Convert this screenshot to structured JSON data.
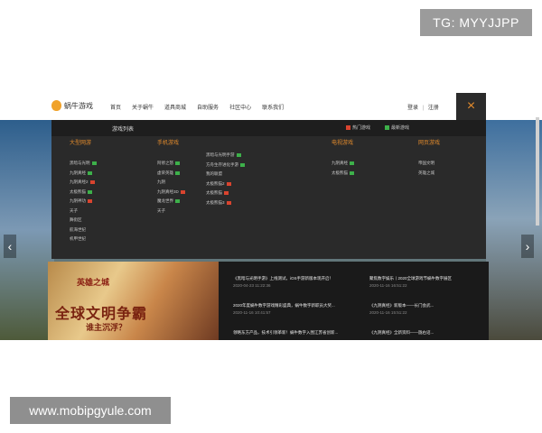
{
  "watermarks": {
    "top": "TG: MYYJJPP",
    "bottom": "www.mobipgyule.com"
  },
  "header": {
    "logo_text": "蜗牛游戏",
    "nav": [
      "首页",
      "关于蜗牛",
      "道具商城",
      "自助服务",
      "社区中心",
      "联系我们"
    ],
    "login": "登录",
    "sep": "|",
    "register": "注册",
    "close_icon": "×"
  },
  "menu": {
    "title": "游戏列表",
    "legend_hot": "热门游戏",
    "legend_new": "最新游戏",
    "colors": {
      "hot": "#d9442f",
      "new": "#3db04a",
      "accent": "#e38b2c"
    },
    "columns": [
      {
        "heading": "大型网游",
        "items": [
          {
            "label": "黑暗与光明",
            "tag": "new"
          },
          {
            "label": "九阴真经",
            "tag": "new"
          },
          {
            "label": "九阴真经2",
            "tag": "hot"
          },
          {
            "label": "太极熊猫",
            "tag": "new"
          },
          {
            "label": "九阴神功",
            "tag": "hot"
          },
          {
            "label": "天子",
            "tag": ""
          },
          {
            "label": "舞街区",
            "tag": ""
          },
          {
            "label": "航海世纪",
            "tag": ""
          },
          {
            "label": "机甲世纪",
            "tag": ""
          }
        ]
      },
      {
        "heading": "手机游戏",
        "items": [
          {
            "label": "阿修之怒",
            "tag": "new"
          },
          {
            "label": "虚荣英雄",
            "tag": "new"
          },
          {
            "label": "九阴",
            "tag": ""
          },
          {
            "label": "九阴真经3D",
            "tag": "hot"
          },
          {
            "label": "魔龙世界",
            "tag": "new"
          },
          {
            "label": "天子",
            "tag": ""
          }
        ]
      },
      {
        "heading": "",
        "items": [
          {
            "label": "黑暗与光明手游",
            "tag": "new"
          },
          {
            "label": "方舟生存进化手游",
            "tag": "new"
          },
          {
            "label": "我的联盟",
            "tag": ""
          },
          {
            "label": "太极熊猫2",
            "tag": "hot"
          },
          {
            "label": "太极熊猫",
            "tag": "hot"
          },
          {
            "label": "太极熊猫3",
            "tag": "hot"
          }
        ]
      },
      {
        "heading": "电视游戏",
        "items": [
          {
            "label": "九阴真经",
            "tag": "new"
          },
          {
            "label": "太极熊猫",
            "tag": "new"
          }
        ]
      },
      {
        "heading": "网页游戏",
        "items": [
          {
            "label": "帝国文明",
            "tag": ""
          },
          {
            "label": "英雄之城",
            "tag": ""
          }
        ]
      }
    ]
  },
  "carousel": {
    "prev_icon": "‹",
    "next_icon": "›"
  },
  "promo": {
    "game_title": "英雄之城",
    "slogan": "全球文明争霸",
    "sub": "谁主沉浮？"
  },
  "news": [
    {
      "title": "《黑暗与光明手游》上线测试，iOS手游新版本现开启！",
      "date": "2020-04-23 11:22:36"
    },
    {
      "title": "聚焦数字娱乐丨2020全球游戏节蜗牛数字展区",
      "date": "2020-11-16 16:51:22"
    },
    {
      "title": "2020年度蜗牛数字游戏精彩盛典，蜗牛数字新职员大奖...",
      "date": "2020-11-16 10:41:57"
    },
    {
      "title": "《九阴真经》新版本——长门会武...",
      "date": "2020-11-16 15:51:22"
    },
    {
      "title": "领略东方产品，技术引领革新！蜗牛数字入围江苏省创新...",
      "date": ""
    },
    {
      "title": "《九阴真经》全新资料——陇右诏...",
      "date": "2020-06-02 11:23:45"
    }
  ]
}
